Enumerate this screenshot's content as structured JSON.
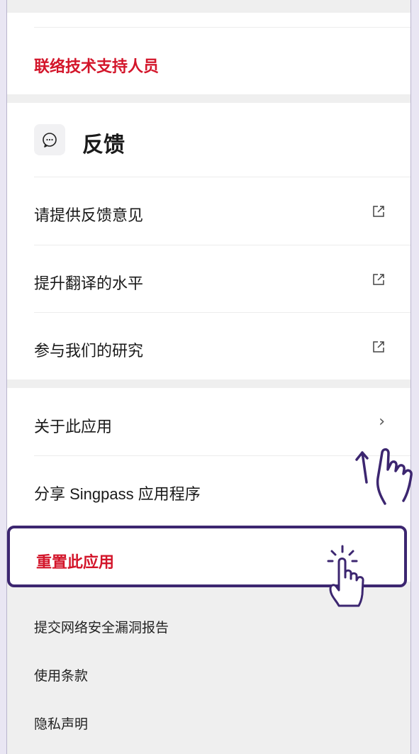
{
  "contact": {
    "label": "联络技术支持人员"
  },
  "feedback": {
    "title": "反馈",
    "items": [
      {
        "label": "请提供反馈意见"
      },
      {
        "label": "提升翻译的水平"
      },
      {
        "label": "参与我们的研究"
      }
    ]
  },
  "app": {
    "items": [
      {
        "label": "关于此应用"
      },
      {
        "label": "分享 Singpass 应用程序"
      }
    ],
    "reset_label": "重置此应用"
  },
  "footer": {
    "links": [
      {
        "label": "提交网络安全漏洞报告"
      },
      {
        "label": "使用条款"
      },
      {
        "label": "隐私声明"
      }
    ]
  },
  "colors": {
    "accent_red": "#d3152a",
    "highlight_border": "#3c2670",
    "background": "#e9e6f3"
  }
}
